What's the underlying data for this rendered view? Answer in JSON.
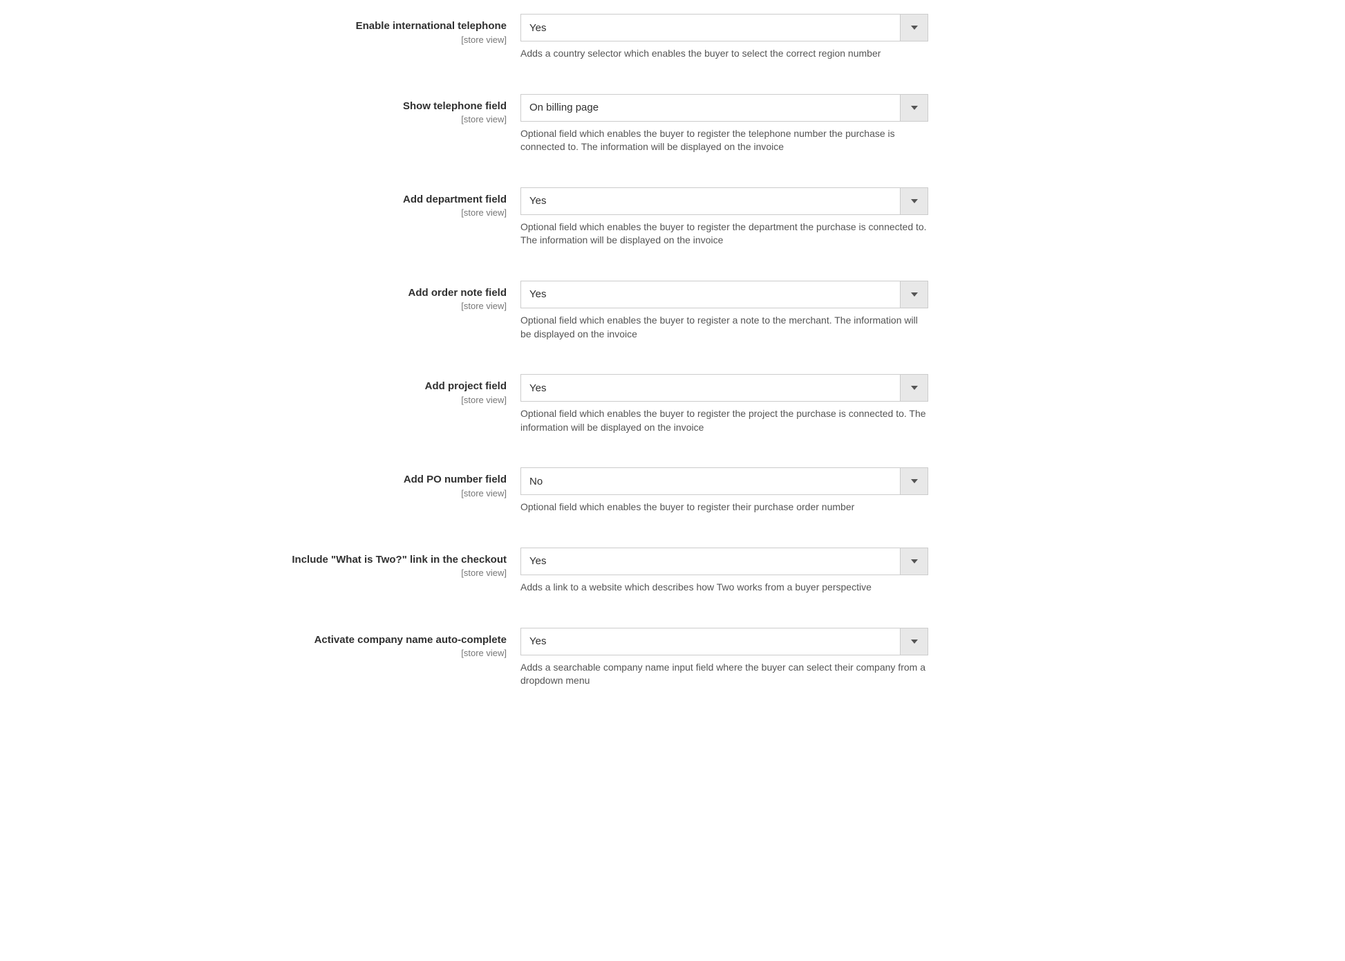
{
  "scope_label": "[store view]",
  "fields": [
    {
      "key": "intl_phone",
      "label": "Enable international telephone",
      "value": "Yes",
      "hint": "Adds a country selector which enables the buyer to select the correct region number"
    },
    {
      "key": "show_phone",
      "label": "Show telephone field",
      "value": "On billing page",
      "hint": "Optional field which enables the buyer to register the telephone number the purchase is connected to. The information will be displayed on the invoice"
    },
    {
      "key": "department",
      "label": "Add department field",
      "value": "Yes",
      "hint": "Optional field which enables the buyer to register the department the purchase is connected to. The information will be displayed on the invoice"
    },
    {
      "key": "order_note",
      "label": "Add order note field",
      "value": "Yes",
      "hint": "Optional field which enables the buyer to register a note to the merchant. The information will be displayed on the invoice"
    },
    {
      "key": "project",
      "label": "Add project field",
      "value": "Yes",
      "hint": "Optional field which enables the buyer to register the project the purchase is connected to. The information will be displayed on the invoice"
    },
    {
      "key": "po_number",
      "label": "Add PO number field",
      "value": "No",
      "hint": "Optional field which enables the buyer to register their purchase order number"
    },
    {
      "key": "what_is_two",
      "label": "Include \"What is Two?\" link in the checkout",
      "value": "Yes",
      "hint": "Adds a link to a website which describes how Two works from a buyer perspective"
    },
    {
      "key": "company_autocomplete",
      "label": "Activate company name auto-complete",
      "value": "Yes",
      "hint": "Adds a searchable company name input field where the buyer can select their company from a dropdown menu"
    }
  ]
}
